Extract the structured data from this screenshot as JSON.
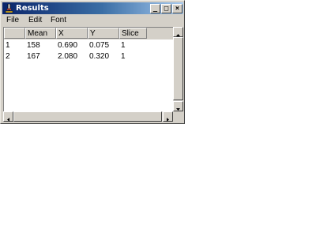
{
  "window": {
    "title": "Results",
    "buttons": {
      "minimize": "_",
      "maximize": "□",
      "close": "×"
    }
  },
  "menu": {
    "items": [
      "File",
      "Edit",
      "Font"
    ]
  },
  "table": {
    "columns": [
      "",
      "Mean",
      "X",
      "Y",
      "Slice"
    ],
    "rows": [
      [
        "1",
        "158",
        "0.690",
        "0.075",
        "1"
      ],
      [
        "2",
        "167",
        "2.080",
        "0.320",
        "1"
      ]
    ]
  },
  "icons": {
    "app": "imagej-microscope-icon"
  },
  "colors": {
    "title_gradient_start": "#0a246a",
    "title_gradient_end": "#a6caf0",
    "chrome": "#d4d0c8"
  }
}
